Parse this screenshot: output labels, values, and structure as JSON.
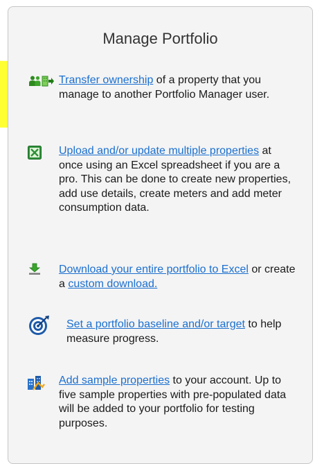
{
  "panel": {
    "title": "Manage Portfolio"
  },
  "items": [
    {
      "icon": "transfer-people-icon",
      "link": "Transfer ownership",
      "text": " of a property that you manage to another Portfolio Manager user."
    },
    {
      "icon": "excel-icon",
      "link": "Upload and/or update multiple properties",
      "text": " at once using an Excel spreadsheet if you are a pro. This can be done to create new properties, add use details, create meters and add meter consumption data."
    },
    {
      "icon": "download-arrow-icon",
      "link": "Download your entire portfolio to Excel",
      "text_mid": " or create a ",
      "link2": "custom download."
    },
    {
      "icon": "target-icon",
      "link": "Set a portfolio baseline and/or target",
      "text": " to help measure progress."
    },
    {
      "icon": "sample-buildings-icon",
      "link": "Add sample properties",
      "text": " to your account. Up to five sample properties with pre-populated data will be added to your portfolio for testing purposes."
    }
  ]
}
